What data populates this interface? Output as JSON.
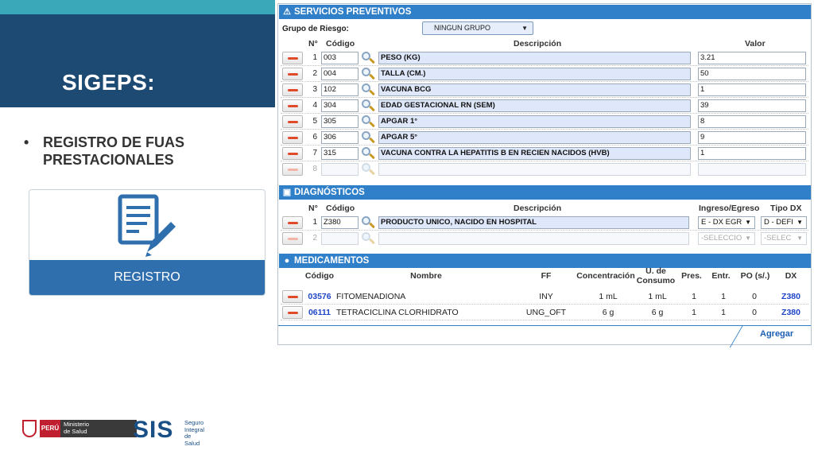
{
  "slide": {
    "title": "SIGEPS:",
    "bullet_marker": "•",
    "bullet_text": "REGISTRO DE FUAS PRESTACIONALES",
    "card_label": "REGISTRO"
  },
  "servicios": {
    "header": "SERVICIOS PREVENTIVOS",
    "grupo_label": "Grupo de Riesgo:",
    "grupo_value": "NINGUN GRUPO",
    "col_n": "N°",
    "col_codigo": "Código",
    "col_descripcion": "Descripción",
    "col_valor": "Valor",
    "rows": [
      {
        "n": "1",
        "codigo": "003",
        "descripcion": "PESO (KG)",
        "valor": "3.21"
      },
      {
        "n": "2",
        "codigo": "004",
        "descripcion": "TALLA (CM.)",
        "valor": "50"
      },
      {
        "n": "3",
        "codigo": "102",
        "descripcion": "VACUNA BCG",
        "valor": "1"
      },
      {
        "n": "4",
        "codigo": "304",
        "descripcion": "EDAD GESTACIONAL RN (SEM)",
        "valor": "39"
      },
      {
        "n": "5",
        "codigo": "305",
        "descripcion": "APGAR 1°",
        "valor": "8"
      },
      {
        "n": "6",
        "codigo": "306",
        "descripcion": "APGAR 5°",
        "valor": "9"
      },
      {
        "n": "7",
        "codigo": "315",
        "descripcion": "VACUNA CONTRA LA HEPATITIS B EN RECIEN NACIDOS (HVB)",
        "valor": "1"
      },
      {
        "n": "8",
        "codigo": "",
        "descripcion": "",
        "valor": ""
      }
    ]
  },
  "diagnosticos": {
    "header": "DIAGNÓSTICOS",
    "col_n": "N°",
    "col_codigo": "Código",
    "col_descripcion": "Descripción",
    "col_ingreso": "Ingreso/Egreso",
    "col_tipo": "Tipo DX",
    "rows": [
      {
        "n": "1",
        "codigo": "Z380",
        "descripcion": "PRODUCTO UNICO, NACIDO EN HOSPITAL",
        "ingreso": "E - DX EGR",
        "tipo": "D - DEFI"
      },
      {
        "n": "2",
        "codigo": "",
        "descripcion": "",
        "ingreso": "-SELECCIO",
        "tipo": "-SELEC"
      }
    ]
  },
  "medicamentos": {
    "header": "MEDICAMENTOS",
    "col_codigo": "Código",
    "col_nombre": "Nombre",
    "col_ff": "FF",
    "col_concentracion": "Concentración",
    "col_consumo_1": "U. de",
    "col_consumo_2": "Consumo",
    "col_pres": "Pres.",
    "col_entr": "Entr.",
    "col_po": "PO (s/.)",
    "col_dx": "DX",
    "rows": [
      {
        "codigo": "03576",
        "nombre": "FITOMENADIONA",
        "ff": "INY",
        "concentracion": "1 mL",
        "consumo": "1 mL",
        "pres": "1",
        "entr": "1",
        "po": "0",
        "dx": "Z380"
      },
      {
        "codigo": "06111",
        "nombre": "TETRACICLINA CLORHIDRATO",
        "ff": "UNG_OFT",
        "concentracion": "6 g",
        "consumo": "6 g",
        "pres": "1",
        "entr": "1",
        "po": "0",
        "dx": "Z380"
      }
    ],
    "agregar": "Agregar"
  },
  "footer": {
    "peru_label": "PERÚ",
    "ministerio_1": "Ministerio",
    "ministerio_2": "de Salud",
    "sis": "SIS",
    "sis_sub_1": "Seguro",
    "sis_sub_2": "Integral",
    "sis_sub_3": "de Salud"
  },
  "colors": {
    "section_header": "#2f7fc9",
    "title_block": "#1d4a73",
    "accent_bar": "#3aa8b9",
    "card_footer": "#2f6fae",
    "link": "#1e44c8"
  },
  "icons": [
    "warning-icon",
    "monitor-icon",
    "pills-icon",
    "search-icon",
    "minus-icon",
    "edit-document-icon",
    "dropdown-caret-icon"
  ]
}
